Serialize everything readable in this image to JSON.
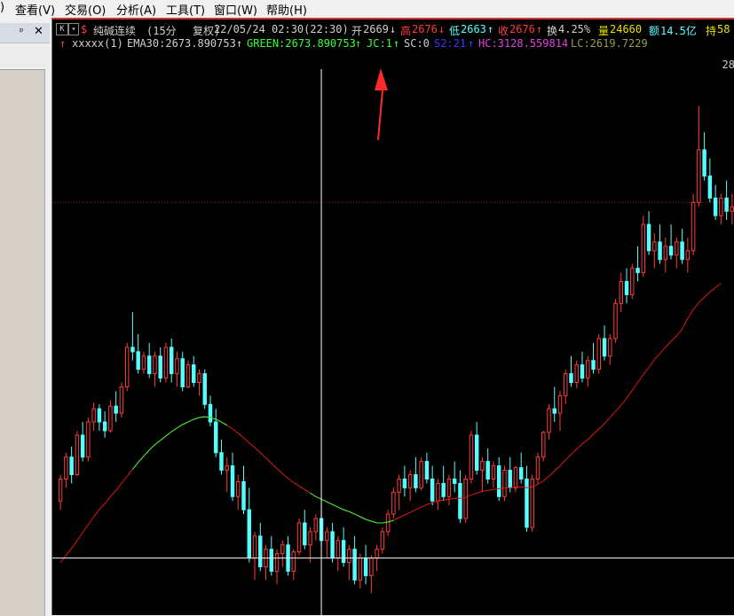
{
  "menu": {
    "items": [
      "查看(V)",
      "交易(O)",
      "分析(A)",
      "工具(T)",
      "窗口(W)",
      "帮助(H)"
    ],
    "partial_left": ")"
  },
  "left_panel": {
    "pin_icon": "pin-icon",
    "close_icon": "close-icon"
  },
  "quote": {
    "symbol_name": "纯碱连续",
    "period": "(15分",
    "adjust": "复权)",
    "datetime": "22/05/24 02:30(22:30)",
    "open_label": "开",
    "open_value": "2669",
    "open_arrow": "↓",
    "high_label": "高",
    "high_value": "2676",
    "high_arrow": "↓",
    "low_label": "低",
    "low_value": "2663",
    "low_arrow": "↑",
    "close_label": "收",
    "close_value": "2676",
    "close_arrow": "↑",
    "turnover_label": "换",
    "turnover_value": "4.25%",
    "volume_label": "量",
    "volume_value": "24660",
    "amount_label": "额",
    "amount_value": "14.5亿",
    "oi_label": "持",
    "oi_value": "58"
  },
  "indicator": {
    "name": "xxxxx(1)",
    "ema": "EMA30:2673.890753",
    "ema_arrow": "↑",
    "green": "GREEN:2673.890753",
    "green_arrow": "↑",
    "jc": "JC:1",
    "jc_arrow": "↑",
    "sc": "SC:0",
    "s2": "S2:21",
    "s2_arrow": "↑",
    "hc": "HC:3128.559814",
    "lc": "LC:2619.7229"
  },
  "price_label_right": "28",
  "colors": {
    "up": "#ff3b3b",
    "down": "#54ffff",
    "ema_red": "#e01818",
    "ema_green": "#33ff33",
    "annotation_arrow": "#ff2a2a"
  },
  "chart_data": {
    "type": "candlestick",
    "indicator_line": "EMA30",
    "ohlc": [
      [
        2610,
        2640,
        2600,
        2635
      ],
      [
        2635,
        2665,
        2625,
        2660
      ],
      [
        2660,
        2672,
        2630,
        2640
      ],
      [
        2640,
        2690,
        2638,
        2685
      ],
      [
        2685,
        2700,
        2655,
        2660
      ],
      [
        2660,
        2705,
        2655,
        2700
      ],
      [
        2700,
        2722,
        2690,
        2715
      ],
      [
        2715,
        2720,
        2690,
        2700
      ],
      [
        2700,
        2712,
        2682,
        2690
      ],
      [
        2690,
        2725,
        2688,
        2718
      ],
      [
        2718,
        2735,
        2700,
        2710
      ],
      [
        2710,
        2745,
        2705,
        2740
      ],
      [
        2740,
        2790,
        2735,
        2785
      ],
      [
        2785,
        2825,
        2770,
        2780
      ],
      [
        2780,
        2800,
        2755,
        2760
      ],
      [
        2760,
        2780,
        2755,
        2775
      ],
      [
        2775,
        2790,
        2750,
        2755
      ],
      [
        2755,
        2780,
        2740,
        2775
      ],
      [
        2775,
        2785,
        2745,
        2750
      ],
      [
        2750,
        2790,
        2745,
        2785
      ],
      [
        2785,
        2795,
        2745,
        2755
      ],
      [
        2755,
        2780,
        2740,
        2772
      ],
      [
        2772,
        2780,
        2735,
        2740
      ],
      [
        2740,
        2770,
        2738,
        2765
      ],
      [
        2765,
        2775,
        2740,
        2745
      ],
      [
        2745,
        2760,
        2730,
        2755
      ],
      [
        2755,
        2760,
        2715,
        2720
      ],
      [
        2720,
        2730,
        2695,
        2700
      ],
      [
        2700,
        2715,
        2660,
        2665
      ],
      [
        2665,
        2680,
        2640,
        2645
      ],
      [
        2645,
        2660,
        2620,
        2650
      ],
      [
        2650,
        2665,
        2610,
        2615
      ],
      [
        2615,
        2640,
        2600,
        2632
      ],
      [
        2632,
        2650,
        2595,
        2600
      ],
      [
        2600,
        2625,
        2540,
        2545
      ],
      [
        2545,
        2575,
        2520,
        2570
      ],
      [
        2570,
        2585,
        2530,
        2535
      ],
      [
        2535,
        2560,
        2520,
        2555
      ],
      [
        2555,
        2570,
        2525,
        2530
      ],
      [
        2530,
        2555,
        2515,
        2550
      ],
      [
        2550,
        2565,
        2535,
        2560
      ],
      [
        2560,
        2570,
        2525,
        2530
      ],
      [
        2530,
        2555,
        2520,
        2552
      ],
      [
        2552,
        2590,
        2548,
        2585
      ],
      [
        2585,
        2600,
        2555,
        2560
      ],
      [
        2560,
        2580,
        2540,
        2575
      ],
      [
        2575,
        2595,
        2565,
        2590
      ],
      [
        2590,
        2600,
        2560,
        2565
      ],
      [
        2565,
        2580,
        2545,
        2575
      ],
      [
        2575,
        2585,
        2540,
        2545
      ],
      [
        2545,
        2570,
        2530,
        2565
      ],
      [
        2565,
        2580,
        2535,
        2540
      ],
      [
        2540,
        2560,
        2520,
        2555
      ],
      [
        2555,
        2570,
        2515,
        2520
      ],
      [
        2520,
        2550,
        2510,
        2545
      ],
      [
        2545,
        2560,
        2515,
        2525
      ],
      [
        2525,
        2548,
        2505,
        2545
      ],
      [
        2545,
        2560,
        2530,
        2555
      ],
      [
        2555,
        2580,
        2550,
        2575
      ],
      [
        2575,
        2600,
        2570,
        2595
      ],
      [
        2595,
        2625,
        2590,
        2620
      ],
      [
        2620,
        2640,
        2600,
        2635
      ],
      [
        2635,
        2650,
        2615,
        2625
      ],
      [
        2625,
        2645,
        2610,
        2640
      ],
      [
        2640,
        2660,
        2620,
        2625
      ],
      [
        2625,
        2660,
        2622,
        2655
      ],
      [
        2655,
        2665,
        2630,
        2635
      ],
      [
        2635,
        2650,
        2605,
        2610
      ],
      [
        2610,
        2635,
        2600,
        2630
      ],
      [
        2630,
        2650,
        2610,
        2615
      ],
      [
        2615,
        2640,
        2605,
        2635
      ],
      [
        2635,
        2655,
        2620,
        2630
      ],
      [
        2630,
        2645,
        2585,
        2590
      ],
      [
        2590,
        2640,
        2585,
        2635
      ],
      [
        2635,
        2690,
        2630,
        2685
      ],
      [
        2685,
        2700,
        2640,
        2645
      ],
      [
        2645,
        2660,
        2620,
        2655
      ],
      [
        2655,
        2670,
        2630,
        2635
      ],
      [
        2635,
        2655,
        2625,
        2650
      ],
      [
        2650,
        2660,
        2610,
        2615
      ],
      [
        2615,
        2650,
        2610,
        2645
      ],
      [
        2645,
        2660,
        2620,
        2625
      ],
      [
        2625,
        2650,
        2620,
        2648
      ],
      [
        2648,
        2665,
        2630,
        2635
      ],
      [
        2635,
        2650,
        2575,
        2580
      ],
      [
        2580,
        2640,
        2575,
        2635
      ],
      [
        2635,
        2665,
        2630,
        2660
      ],
      [
        2660,
        2690,
        2655,
        2688
      ],
      [
        2688,
        2720,
        2680,
        2715
      ],
      [
        2715,
        2740,
        2700,
        2710
      ],
      [
        2710,
        2735,
        2690,
        2730
      ],
      [
        2730,
        2760,
        2720,
        2755
      ],
      [
        2755,
        2775,
        2740,
        2745
      ],
      [
        2745,
        2770,
        2738,
        2765
      ],
      [
        2765,
        2780,
        2745,
        2750
      ],
      [
        2750,
        2775,
        2740,
        2770
      ],
      [
        2770,
        2790,
        2755,
        2760
      ],
      [
        2760,
        2800,
        2755,
        2795
      ],
      [
        2795,
        2810,
        2770,
        2775
      ],
      [
        2775,
        2800,
        2765,
        2795
      ],
      [
        2795,
        2840,
        2790,
        2835
      ],
      [
        2835,
        2870,
        2825,
        2860
      ],
      [
        2860,
        2875,
        2835,
        2845
      ],
      [
        2845,
        2880,
        2840,
        2875
      ],
      [
        2875,
        2900,
        2860,
        2870
      ],
      [
        2870,
        2935,
        2865,
        2925
      ],
      [
        2925,
        2940,
        2890,
        2895
      ],
      [
        2895,
        2915,
        2875,
        2905
      ],
      [
        2905,
        2925,
        2880,
        2885
      ],
      [
        2885,
        2910,
        2870,
        2900
      ],
      [
        2900,
        2925,
        2885,
        2890
      ],
      [
        2890,
        2910,
        2875,
        2905
      ],
      [
        2905,
        2920,
        2880,
        2885
      ],
      [
        2885,
        2910,
        2870,
        2895
      ],
      [
        2895,
        2960,
        2890,
        2950
      ],
      [
        2950,
        3060,
        2945,
        3010
      ],
      [
        3010,
        3030,
        2975,
        2980
      ],
      [
        2980,
        3000,
        2950,
        2955
      ],
      [
        2955,
        2970,
        2930,
        2935
      ],
      [
        2935,
        2960,
        2925,
        2955
      ],
      [
        2955,
        2975,
        2930,
        2940
      ],
      [
        2940,
        2960,
        2925,
        2945
      ]
    ],
    "ema30": [
      2540,
      2548,
      2556,
      2565,
      2574,
      2583,
      2592,
      2600,
      2607,
      2615,
      2622,
      2630,
      2638,
      2646,
      2654,
      2661,
      2668,
      2674,
      2679,
      2684,
      2689,
      2693,
      2697,
      2700,
      2703,
      2705,
      2706,
      2705,
      2703,
      2700,
      2696,
      2692,
      2687,
      2682,
      2676,
      2671,
      2665,
      2659,
      2653,
      2647,
      2641,
      2636,
      2631,
      2627,
      2623,
      2619,
      2615,
      2612,
      2609,
      2606,
      2603,
      2600,
      2598,
      2595,
      2592,
      2589,
      2587,
      2585,
      2585,
      2586,
      2588,
      2591,
      2594,
      2597,
      2600,
      2603,
      2606,
      2608,
      2610,
      2611,
      2612,
      2613,
      2613,
      2614,
      2617,
      2619,
      2621,
      2622,
      2623,
      2624,
      2625,
      2625,
      2626,
      2626,
      2625,
      2626,
      2629,
      2633,
      2638,
      2644,
      2650,
      2657,
      2663,
      2669,
      2675,
      2680,
      2686,
      2692,
      2698,
      2705,
      2712,
      2719,
      2727,
      2736,
      2745,
      2754,
      2762,
      2771,
      2778,
      2785,
      2792,
      2798,
      2806,
      2818,
      2828,
      2836,
      2842,
      2848,
      2853,
      2858
    ],
    "green_segments": [
      [
        13,
        30
      ],
      [
        45,
        60
      ]
    ],
    "crosshair_index": 47,
    "horizontal_ref_price": 2545,
    "dotted_ref_price": 2950,
    "ylim": [
      2480,
      3120
    ]
  }
}
